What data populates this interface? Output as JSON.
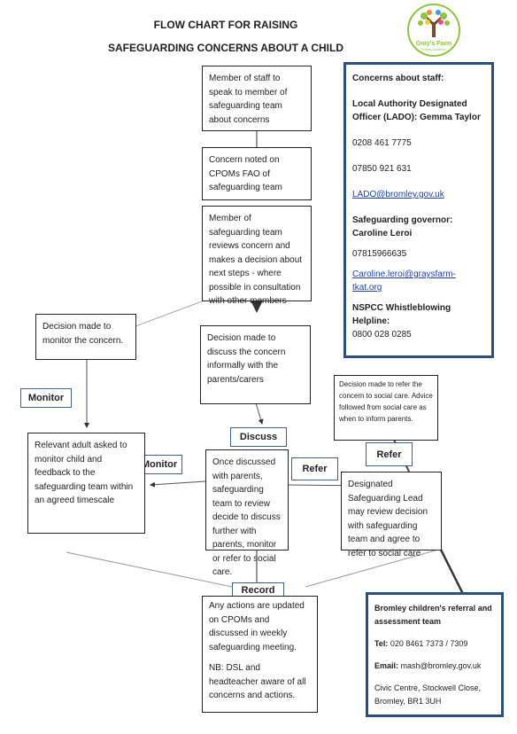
{
  "title": {
    "line1": "FLOW CHART FOR RAISING",
    "line2": "SAFEGUARDING CONCERNS ABOUT A CHILD"
  },
  "logo": {
    "name": "Gray's Farm",
    "subtitle": "Primary Academy",
    "accent": "#8cc63f"
  },
  "flow": {
    "step1": "Member of staff to speak to member of safeguarding team about concerns",
    "step2": "Concern noted on CPOMs FAO of safeguarding team",
    "step3": "Member of safeguarding team reviews concern and makes a decision about next steps - where possible in consultation with other members",
    "monitor_decision": "Decision made to monitor the concern.",
    "discuss_decision": "Decision made to discuss the concern informally with the parents/carers",
    "refer_decision": "Decision made to refer the concern to social care. Advice followed from social care as when to inform parents.",
    "monitor_label": "Monitor",
    "discuss_label": "Discuss",
    "refer_label": "Refer",
    "record_label": "Record",
    "relevant_adult": "Relevant adult asked to monitor child and feedback to the safeguarding team within an agreed timescale",
    "once_discussed": "Once discussed with parents, safeguarding team to review decide to discuss further with parents, monitor or refer to social care.",
    "designated_lead": "Designated Safeguarding Lead may review decision with safeguarding team and agree to refer to social care",
    "actions_1": "Any actions are updated on CPOMs and discussed in weekly safeguarding meeting.",
    "actions_2": "NB: DSL and headteacher aware of all concerns and actions."
  },
  "staff": {
    "heading": "Concerns about staff:",
    "lado": "Local Authority Designated Officer (LADO): Gemma Taylor",
    "phone1": "0208 461 7775",
    "phone2": "07850 921 631",
    "email": "LADO@bromley.gov.uk",
    "governor": "Safeguarding governor: Caroline Leroi",
    "gov_phone": "07815966635",
    "gov_email": "Caroline.leroi@graysfarm-tkat.org",
    "nspcc_label": "NSPCC Whistleblowing Helpline:",
    "nspcc_phone": "0800 028 0285"
  },
  "bromley": {
    "heading": "Bromley children's referral and assessment team",
    "tel_label": "Tel:",
    "tel": "020 8461 7373 / 7309",
    "email_label": "Email:",
    "email": "mash@bromley.gov.uk",
    "address": "Civic Centre, Stockwell Close, Bromley, BR1 3UH"
  }
}
